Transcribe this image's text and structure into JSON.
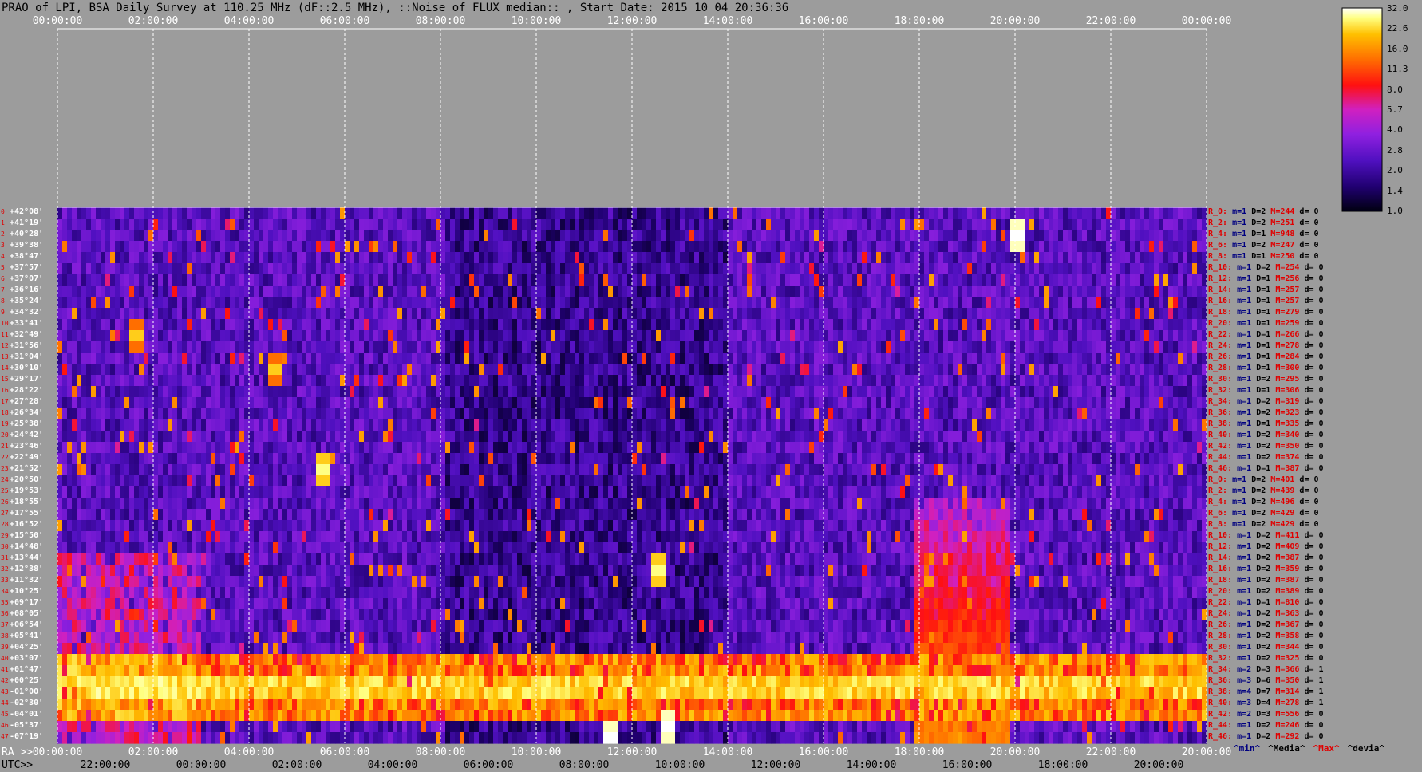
{
  "title": "PRAO of LPI, BSA Daily Survey at 110.25 MHz (dF::2.5 MHz), ::Noise_of_FLUX_median:: , Start Date: 2015 10 04 20:36:36",
  "chart_data": {
    "type": "heatmap",
    "top_time_ticks": [
      "00:00:00",
      "02:00:00",
      "04:00:00",
      "06:00:00",
      "08:00:00",
      "10:00:00",
      "12:00:00",
      "14:00:00",
      "16:00:00",
      "18:00:00",
      "20:00:00",
      "22:00:00",
      "00:00:00"
    ],
    "ra_label": "RA >>",
    "ra_ticks": [
      "00:00:00",
      "02:00:00",
      "04:00:00",
      "06:00:00",
      "08:00:00",
      "10:00:00",
      "12:00:00",
      "14:00:00",
      "16:00:00",
      "18:00:00",
      "20:00:00",
      "22:00:00",
      "20:00:00"
    ],
    "utc_label": "UTC>>",
    "utc_ticks": [
      "22:00:00",
      "00:00:00",
      "02:00:00",
      "04:00:00",
      "06:00:00",
      "08:00:00",
      "10:00:00",
      "12:00:00",
      "14:00:00",
      "16:00:00",
      "18:00:00",
      "20:00:00"
    ],
    "declinations": [
      "+42°08'",
      "+41°19'",
      "+40°28'",
      "+39°38'",
      "+38°47'",
      "+37°57'",
      "+37°07'",
      "+36°16'",
      "+35°24'",
      "+34°32'",
      "+33°41'",
      "+32°49'",
      "+31°56'",
      "+31°04'",
      "+30°10'",
      "+29°17'",
      "+28°22'",
      "+27°28'",
      "+26°34'",
      "+25°38'",
      "+24°42'",
      "+23°46'",
      "+22°49'",
      "+21°52'",
      "+20°50'",
      "+19°53'",
      "+18°55'",
      "+17°55'",
      "+16°52'",
      "+15°50'",
      "+14°48'",
      "+13°44'",
      "+12°38'",
      "+11°32'",
      "+10°25'",
      "+09°17'",
      "+08°05'",
      "+06°54'",
      "+05°41'",
      "+04°25'",
      "+03°07'",
      "+01°47'",
      "+00°25'",
      "-01°00'",
      "-02°30'",
      "-04°01'",
      "-05°37'",
      "-07°19'"
    ],
    "row_indices": [
      "0",
      "1",
      "2",
      "3",
      "4",
      "5",
      "6",
      "7",
      "8",
      "9",
      "10",
      "11",
      "12",
      "13",
      "14",
      "15",
      "16",
      "17",
      "18",
      "19",
      "20",
      "21",
      "22",
      "23",
      "24",
      "25",
      "26",
      "27",
      "28",
      "29",
      "30",
      "31",
      "32",
      "33",
      "34",
      "35",
      "36",
      "37",
      "38",
      "39",
      "40",
      "41",
      "42",
      "43",
      "44",
      "45",
      "46",
      "47"
    ],
    "colorbar": {
      "ticks": [
        "32.0",
        "22.6",
        "16.0",
        "11.3",
        "8.0",
        "5.7",
        "4.0",
        "2.8",
        "2.0",
        "1.4",
        "1.0"
      ],
      "scale": "log",
      "range": [
        1.0,
        32.0
      ],
      "colors": [
        "#000010",
        "#200070",
        "#5010c0",
        "#9020e0",
        "#d020c0",
        "#ff1010",
        "#ff7000",
        "#ffc000",
        "#ffff80",
        "#ffffff"
      ]
    },
    "stats": [
      {
        "r": "R_0:",
        "m": "m=1",
        "d": "D=2",
        "M": "M=244",
        "dev": "d= 0"
      },
      {
        "r": "R_2:",
        "m": "m=1",
        "d": "D=2",
        "M": "M=251",
        "dev": "d= 0"
      },
      {
        "r": "R_4:",
        "m": "m=1",
        "d": "D=1",
        "M": "M=948",
        "dev": "d= 0"
      },
      {
        "r": "R_6:",
        "m": "m=1",
        "d": "D=2",
        "M": "M=247",
        "dev": "d= 0"
      },
      {
        "r": "R_8:",
        "m": "m=1",
        "d": "D=1",
        "M": "M=250",
        "dev": "d= 0"
      },
      {
        "r": "R_10:",
        "m": "m=1",
        "d": "D=2",
        "M": "M=254",
        "dev": "d= 0"
      },
      {
        "r": "R_12:",
        "m": "m=1",
        "d": "D=1",
        "M": "M=256",
        "dev": "d= 0"
      },
      {
        "r": "R_14:",
        "m": "m=1",
        "d": "D=1",
        "M": "M=257",
        "dev": "d= 0"
      },
      {
        "r": "R_16:",
        "m": "m=1",
        "d": "D=1",
        "M": "M=257",
        "dev": "d= 0"
      },
      {
        "r": "R_18:",
        "m": "m=1",
        "d": "D=1",
        "M": "M=279",
        "dev": "d= 0"
      },
      {
        "r": "R_20:",
        "m": "m=1",
        "d": "D=1",
        "M": "M=259",
        "dev": "d= 0"
      },
      {
        "r": "R_22:",
        "m": "m=1",
        "d": "D=1",
        "M": "M=266",
        "dev": "d= 0"
      },
      {
        "r": "R_24:",
        "m": "m=1",
        "d": "D=1",
        "M": "M=278",
        "dev": "d= 0"
      },
      {
        "r": "R_26:",
        "m": "m=1",
        "d": "D=1",
        "M": "M=284",
        "dev": "d= 0"
      },
      {
        "r": "R_28:",
        "m": "m=1",
        "d": "D=1",
        "M": "M=300",
        "dev": "d= 0"
      },
      {
        "r": "R_30:",
        "m": "m=1",
        "d": "D=2",
        "M": "M=295",
        "dev": "d= 0"
      },
      {
        "r": "R_32:",
        "m": "m=1",
        "d": "D=1",
        "M": "M=306",
        "dev": "d= 0"
      },
      {
        "r": "R_34:",
        "m": "m=1",
        "d": "D=2",
        "M": "M=319",
        "dev": "d= 0"
      },
      {
        "r": "R_36:",
        "m": "m=1",
        "d": "D=2",
        "M": "M=323",
        "dev": "d= 0"
      },
      {
        "r": "R_38:",
        "m": "m=1",
        "d": "D=1",
        "M": "M=335",
        "dev": "d= 0"
      },
      {
        "r": "R_40:",
        "m": "m=1",
        "d": "D=2",
        "M": "M=340",
        "dev": "d= 0"
      },
      {
        "r": "R_42:",
        "m": "m=1",
        "d": "D=2",
        "M": "M=350",
        "dev": "d= 0"
      },
      {
        "r": "R_44:",
        "m": "m=1",
        "d": "D=2",
        "M": "M=374",
        "dev": "d= 0"
      },
      {
        "r": "R_46:",
        "m": "m=1",
        "d": "D=1",
        "M": "M=387",
        "dev": "d= 0"
      },
      {
        "r": "R_0:",
        "m": "m=1",
        "d": "D=2",
        "M": "M=401",
        "dev": "d= 0"
      },
      {
        "r": "R_2:",
        "m": "m=1",
        "d": "D=2",
        "M": "M=439",
        "dev": "d= 0"
      },
      {
        "r": "R_4:",
        "m": "m=1",
        "d": "D=2",
        "M": "M=496",
        "dev": "d= 0"
      },
      {
        "r": "R_6:",
        "m": "m=1",
        "d": "D=2",
        "M": "M=429",
        "dev": "d= 0"
      },
      {
        "r": "R_8:",
        "m": "m=1",
        "d": "D=2",
        "M": "M=429",
        "dev": "d= 0"
      },
      {
        "r": "R_10:",
        "m": "m=1",
        "d": "D=2",
        "M": "M=411",
        "dev": "d= 0"
      },
      {
        "r": "R_12:",
        "m": "m=1",
        "d": "D=2",
        "M": "M=409",
        "dev": "d= 0"
      },
      {
        "r": "R_14:",
        "m": "m=1",
        "d": "D=2",
        "M": "M=387",
        "dev": "d= 0"
      },
      {
        "r": "R_16:",
        "m": "m=1",
        "d": "D=2",
        "M": "M=359",
        "dev": "d= 0"
      },
      {
        "r": "R_18:",
        "m": "m=1",
        "d": "D=2",
        "M": "M=387",
        "dev": "d= 0"
      },
      {
        "r": "R_20:",
        "m": "m=1",
        "d": "D=2",
        "M": "M=389",
        "dev": "d= 0"
      },
      {
        "r": "R_22:",
        "m": "m=1",
        "d": "D=1",
        "M": "M=810",
        "dev": "d= 0"
      },
      {
        "r": "R_24:",
        "m": "m=1",
        "d": "D=2",
        "M": "M=363",
        "dev": "d= 0"
      },
      {
        "r": "R_26:",
        "m": "m=1",
        "d": "D=2",
        "M": "M=367",
        "dev": "d= 0"
      },
      {
        "r": "R_28:",
        "m": "m=1",
        "d": "D=2",
        "M": "M=358",
        "dev": "d= 0"
      },
      {
        "r": "R_30:",
        "m": "m=1",
        "d": "D=2",
        "M": "M=344",
        "dev": "d= 0"
      },
      {
        "r": "R_32:",
        "m": "m=1",
        "d": "D=2",
        "M": "M=325",
        "dev": "d= 0"
      },
      {
        "r": "R_34:",
        "m": "m=2",
        "d": "D=3",
        "M": "M=366",
        "dev": "d= 1"
      },
      {
        "r": "R_36:",
        "m": "m=3",
        "d": "D=6",
        "M": "M=350",
        "dev": "d= 1"
      },
      {
        "r": "R_38:",
        "m": "m=4",
        "d": "D=7",
        "M": "M=314",
        "dev": "d= 1"
      },
      {
        "r": "R_40:",
        "m": "m=3",
        "d": "D=4",
        "M": "M=278",
        "dev": "d= 1"
      },
      {
        "r": "R_42:",
        "m": "m=2",
        "d": "D=3",
        "M": "M=556",
        "dev": "d= 0"
      },
      {
        "r": "R_44:",
        "m": "m=1",
        "d": "D=2",
        "M": "M=246",
        "dev": "d= 0"
      },
      {
        "r": "R_46:",
        "m": "m=1",
        "d": "D=2",
        "M": "M=292",
        "dev": "d= 0"
      }
    ],
    "legend_line": [
      {
        "text": "^min^",
        "color": "#000080"
      },
      {
        "text": "^Media^",
        "color": "#000000"
      },
      {
        "text": "^Max^",
        "color": "#e00000"
      },
      {
        "text": "^devia^",
        "color": "#000000"
      }
    ],
    "features": {
      "equator_band_rows": [
        40,
        45
      ],
      "source_spots": [
        {
          "ra_h": 20.0,
          "row": 2,
          "level": 32
        },
        {
          "ra_h": 5.5,
          "row": 23,
          "level": 22
        },
        {
          "ra_h": 12.5,
          "row": 32,
          "level": 22
        },
        {
          "ra_h": 12.7,
          "row": 46,
          "level": 32
        },
        {
          "ra_h": 11.5,
          "row": 47,
          "level": 32
        },
        {
          "ra_h": 4.5,
          "row": 14,
          "level": 16
        },
        {
          "ra_h": 1.6,
          "row": 11,
          "level": 16
        }
      ]
    }
  }
}
